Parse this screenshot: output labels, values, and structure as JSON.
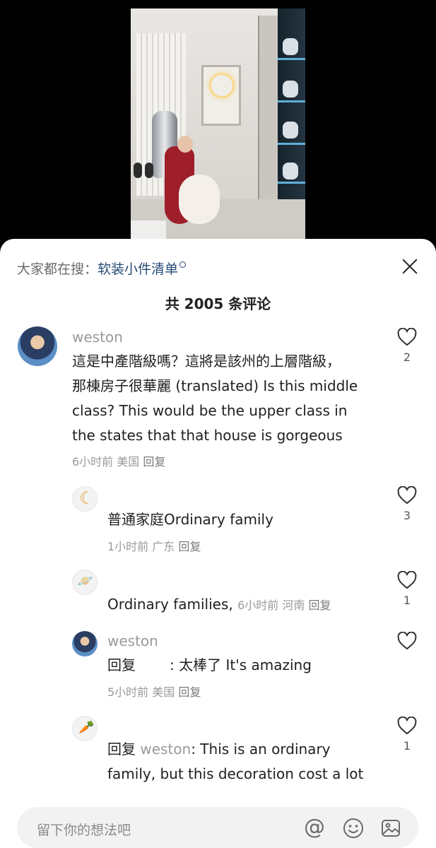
{
  "sheet": {
    "search_prefix": "大家都在搜：",
    "search_term": "软装小件清单",
    "count_title": "共 2005 条评论"
  },
  "comments": [
    {
      "username": "weston",
      "lines": [
        "這是中產階級嗎？這將是該州的上層階級，",
        "那棟房子很華麗 (translated) Is this middle",
        "class? This would be the upper class in",
        "the states that that house is gorgeous"
      ],
      "time": "6小时前",
      "location": "美国",
      "reply_label": "回复",
      "likes": "2"
    },
    {
      "text": "普通家庭Ordinary family",
      "time": "1小时前",
      "location": "广东",
      "reply_label": "回复",
      "likes": "3"
    },
    {
      "text": "Ordinary families,",
      "time": "6小时前",
      "location": "河南",
      "reply_label": "回复",
      "likes": "1"
    },
    {
      "username": "weston",
      "reply_prefix": "回复",
      "text": ": 太棒了   It's amazing",
      "time": "5小时前",
      "location": "美国",
      "reply_label": "回复"
    },
    {
      "reply_prefix": "回复",
      "mention": "weston",
      "lines": [
        ": This is an ordinary",
        "family, but this decoration cost a lot"
      ],
      "likes": "1"
    }
  ],
  "input": {
    "placeholder": "留下你的想法吧"
  },
  "icons": {
    "heart": "heart-outline-icon",
    "close": "close-icon",
    "at": "at-mention-icon",
    "emoji": "emoji-icon",
    "image": "image-icon"
  }
}
